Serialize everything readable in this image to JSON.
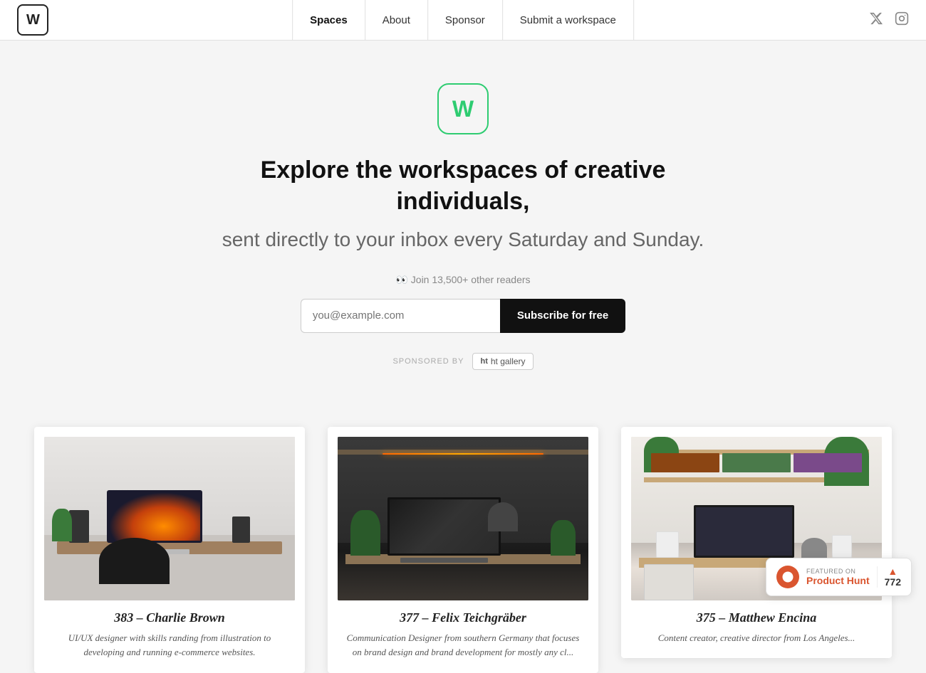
{
  "header": {
    "logo_letter": "W",
    "nav": {
      "spaces": "Spaces",
      "about": "About",
      "sponsor": "Sponsor",
      "submit": "Submit a workspace"
    }
  },
  "hero": {
    "logo_letter": "W",
    "title": "Explore the workspaces of creative individuals,",
    "subtitle": "sent directly to your inbox every Saturday and Sunday.",
    "readers_prefix": "👀 Join 13,500+ other readers",
    "email_placeholder": "you@example.com",
    "subscribe_label": "Subscribe for free",
    "sponsored_label": "SPONSORED BY",
    "sponsor_name": "ht gallery"
  },
  "cards": [
    {
      "number": "383",
      "name": "Charlie Brown",
      "title": "383 – Charlie Brown",
      "description": "UI/UX designer with skills randing from illustration to developing and running e-commerce websites."
    },
    {
      "number": "377",
      "name": "Felix Teichgräber",
      "title": "377 – Felix Teichgräber",
      "description": "Communication Designer from southern Germany that focuses on brand design and brand development for mostly any cl..."
    },
    {
      "number": "375",
      "name": "Matthew Encina",
      "title": "375 – Matthew Encina",
      "description": "Content creator, creative director from Los Angeles..."
    }
  ],
  "product_hunt": {
    "featured_label": "FEATURED ON",
    "product_label": "Product Hunt",
    "vote_count": "772"
  }
}
